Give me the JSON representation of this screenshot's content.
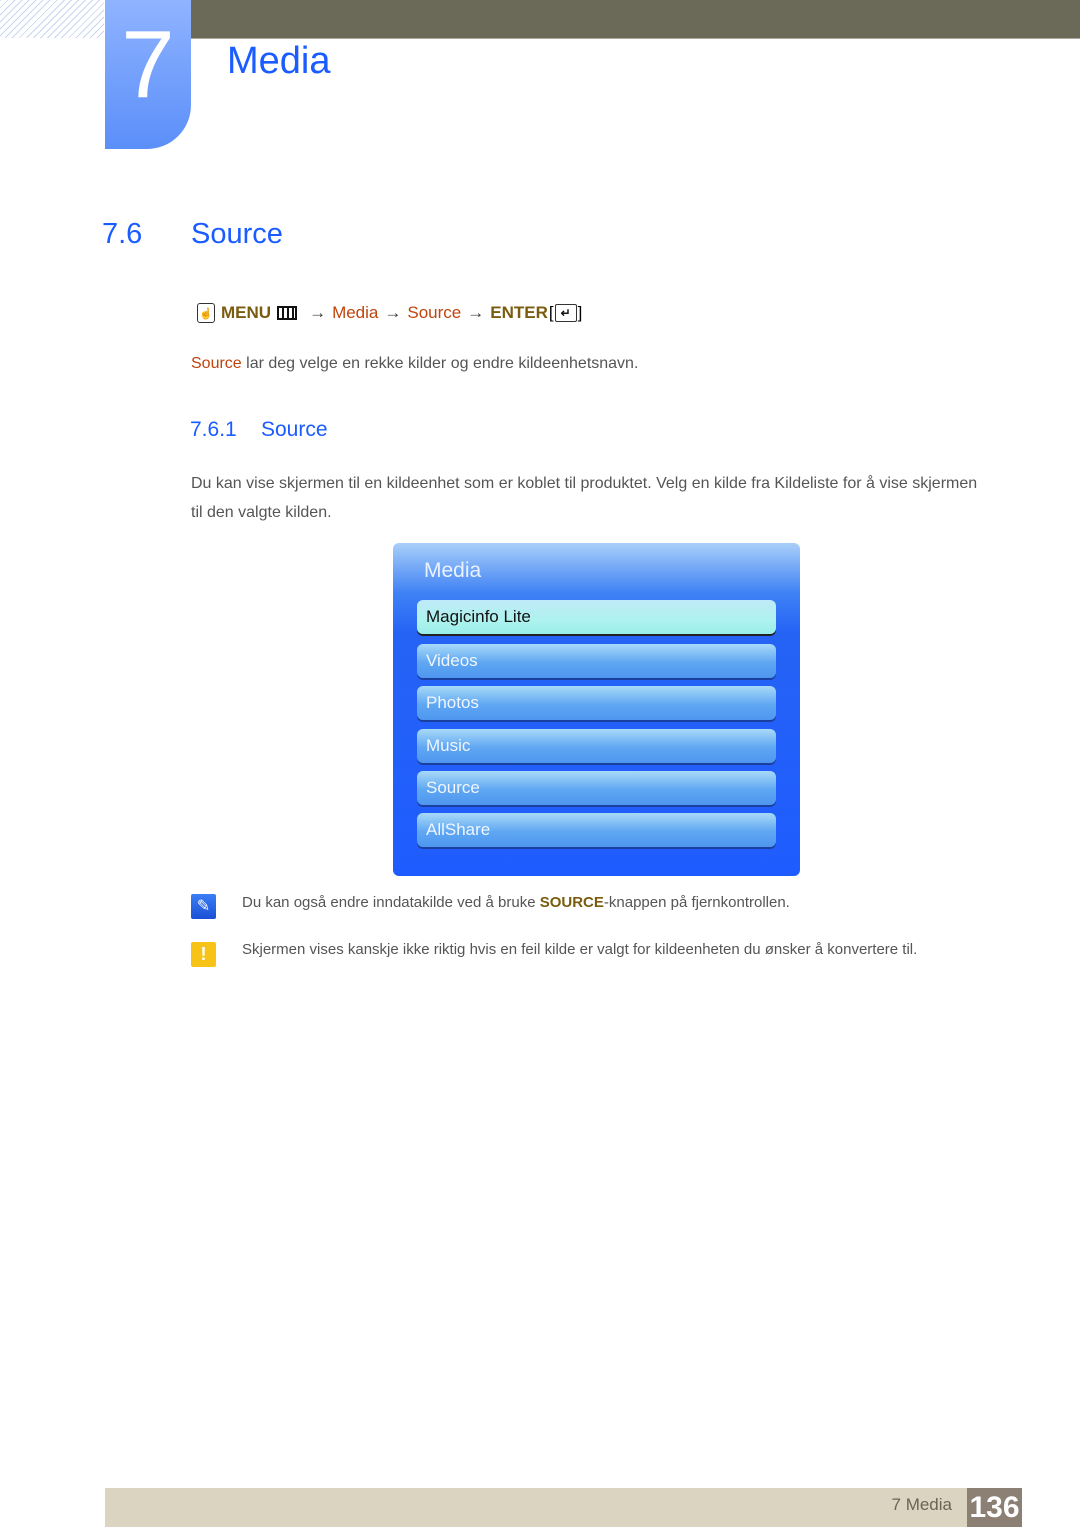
{
  "header": {
    "chapter_number": "7",
    "chapter_title": "Media"
  },
  "section": {
    "number": "7.6",
    "title": "Source"
  },
  "menu_path": {
    "menu_label": "MENU",
    "arrow": "→",
    "steps": [
      "Media",
      "Source"
    ],
    "enter_label": "ENTER",
    "enter_open": "[",
    "enter_close": "]",
    "enter_glyph": "↵",
    "hand_glyph": "☝"
  },
  "intro": {
    "highlight": "Source",
    "text": " lar deg velge en rekke kilder og endre kildeenhetsnavn."
  },
  "subsection": {
    "number": "7.6.1",
    "title": "Source",
    "paragraph": "Du kan vise skjermen til en kildeenhet som er koblet til produktet. Velg en kilde fra Kildeliste for å vise skjermen til den valgte kilden."
  },
  "osd_menu": {
    "title": "Media",
    "items": [
      {
        "label": "Magicinfo Lite",
        "selected": true
      },
      {
        "label": "Videos",
        "selected": false
      },
      {
        "label": "Photos",
        "selected": false
      },
      {
        "label": "Music",
        "selected": false
      },
      {
        "label": "Source",
        "selected": false
      },
      {
        "label": "AllShare",
        "selected": false
      }
    ]
  },
  "notes": [
    {
      "icon": "note-pencil-icon",
      "glyph": "✎",
      "before": "Du kan også endre inndatakilde ved å bruke ",
      "keyword": "SOURCE",
      "after": "-knappen på fjernkontrollen."
    },
    {
      "icon": "warning-icon",
      "glyph": "!",
      "text": "Skjermen vises kanskje ikke riktig hvis en feil kilde er valgt for kildeenheten du ønsker å konvertere til."
    }
  ],
  "footer": {
    "label": "7 Media",
    "page_number": "136"
  },
  "colors": {
    "heading_blue": "#1a5cff",
    "menu_keyword": "#7a5c0f",
    "menu_link": "#c0440d",
    "osd_blue": "#1f5cff",
    "footer_bg": "#dbd4c0",
    "page_num_bg": "#8c8074"
  }
}
